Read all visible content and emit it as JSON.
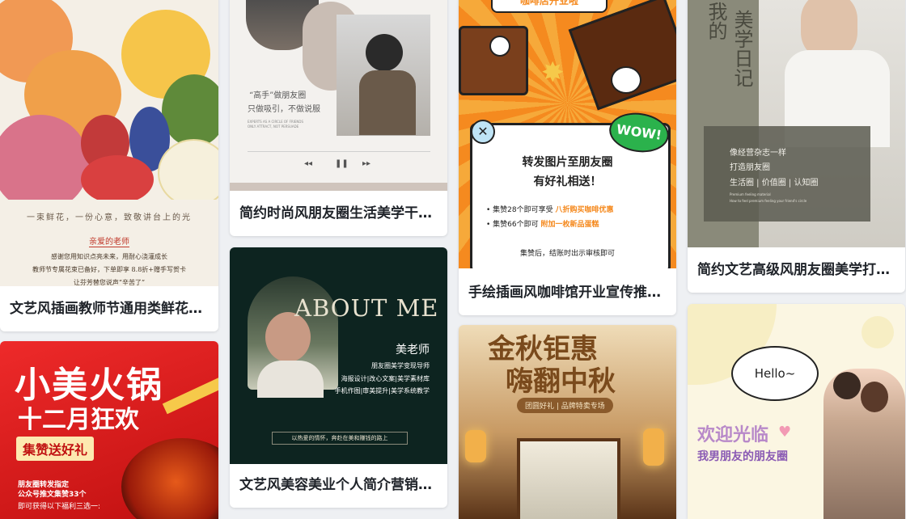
{
  "cards": [
    {
      "title": "文艺风插画教师节通用类鲜花…",
      "poster": {
        "tagline": "一束鲜花，一份心意，致敬讲台上的光",
        "salutation": "亲爱的老师",
        "lines": [
          "感谢您用知识点亮未来，用耐心浇灌成长",
          "教师节专属花束已备好，下单即享 8.8折+赠手写贺卡",
          "让芬芳替您说声“辛苦了”"
        ]
      }
    },
    {
      "title": "简约时尚风朋友圈生活美学干…",
      "poster": {
        "quote1": "“高手”做朋友圈",
        "quote2": "只做吸引，不做说服",
        "small1": "EXPERTS AS A CIRCLE OF FRIENDS",
        "small2": "ONLY ATTRACT, NOT PERSUADE"
      }
    },
    {
      "title": "手绘插画风咖啡馆开业宣传推…",
      "poster": {
        "top_banner": "咖啡店开业啦",
        "wow": "WOW!",
        "line1": "转发图片至朋友圈",
        "line2": "有好礼相送！",
        "bullet1_a": "集赞28个即可享受",
        "bullet1_b": "八折购买咖啡优惠",
        "bullet2_a": "集赞66个即可",
        "bullet2_b": "附加一枚新品蛋糕",
        "footer": "集赞后，结账时出示审核即可"
      }
    },
    {
      "title": "简约文艺高级风朋友圈美学打…",
      "poster": {
        "vertical1": "我的",
        "vertical2": "美学日记",
        "line1": "像经营杂志一样",
        "line2": "打造朋友圈",
        "line3": "生活圈 | 价值圈 | 认知圈",
        "small1": "Premium feeling material",
        "small2": "How to feel premium feeling your friend's circle"
      }
    },
    {
      "title": "",
      "poster": {
        "headline1": "小美火锅",
        "headline2": "十二月狂欢",
        "badge": "集赞送好礼",
        "line1": "朋友圈转发指定",
        "line2": "公众号推文集赞33个",
        "line3": "即可获得以下福利三选一:"
      }
    },
    {
      "title": "文艺风美容美业个人简介营销…",
      "poster": {
        "heading": "ABOUT ME",
        "name": "美老师",
        "role1": "朋友圈美学变现导师",
        "role2": "海报设计|改心文案|美学素材库",
        "role3": "手机作图|审美提升|美学系统教学",
        "slogan": "以热爱的情怀，奔赴在美和赚钱的路上"
      }
    },
    {
      "title": "",
      "poster": {
        "headline1": "金秋钜惠",
        "headline2": "嗨翻中秋",
        "ribbon": "团圆好礼 | 品牌特卖专场"
      }
    },
    {
      "title": "",
      "poster": {
        "bubble": "Hello~",
        "line1": "欢迎光临",
        "line2": "我男朋友的朋友圈"
      }
    }
  ],
  "colors": {
    "cream": "#f4efe6",
    "olive": "#8a8a7a",
    "coffee_orange": "#f58a1f",
    "hotpot_red": "#d71c1c",
    "deep_green": "#0d2420",
    "autumn_brown": "#8a5a2b",
    "pastel_yellow": "#f7eec4"
  }
}
